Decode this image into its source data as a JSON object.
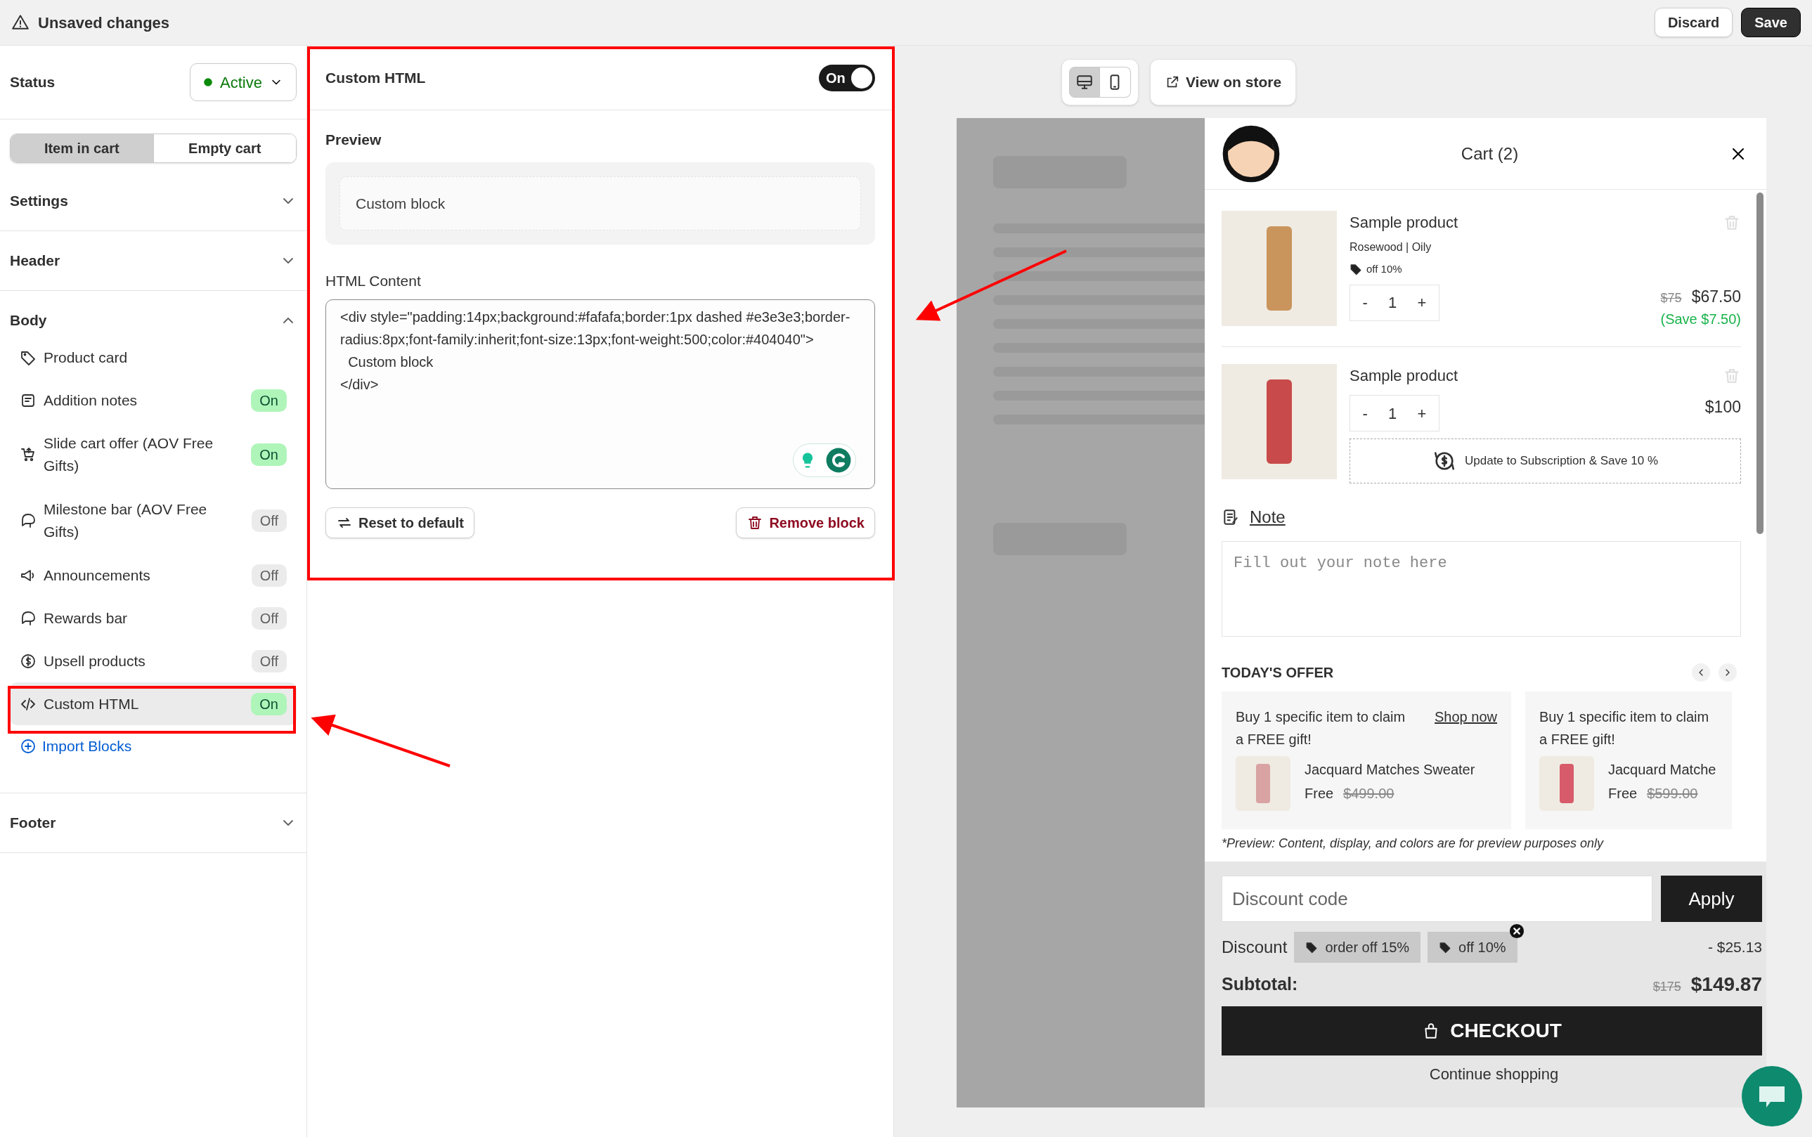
{
  "top_bar": {
    "title": "Unsaved changes",
    "buttons": [
      {
        "label": "Discard",
        "kind": "secondary"
      },
      {
        "label": "Save",
        "kind": "primary"
      }
    ]
  },
  "sidebar": {
    "status": {
      "label": "Status",
      "value": "Active"
    },
    "tabs": [
      {
        "label": "Item in cart",
        "selected": true
      },
      {
        "label": "Empty cart",
        "selected": false
      }
    ],
    "sections": [
      {
        "title": "Settings",
        "expanded": false
      },
      {
        "title": "Header",
        "expanded": false
      },
      {
        "title": "Body",
        "expanded": true,
        "items": [
          {
            "label": "Product card",
            "kind": "plain",
            "selected": false
          },
          {
            "label": "Addition notes",
            "kind": "toggle",
            "badge": "On",
            "on": true,
            "selected": false
          },
          {
            "label": "Slide cart offer (AOV Free Gifts)",
            "kind": "toggle",
            "badge": "On",
            "on": true,
            "selected": false
          },
          {
            "label": "Milestone bar (AOV Free Gifts)",
            "kind": "toggle",
            "badge": "Off",
            "on": false,
            "selected": false
          },
          {
            "label": "Announcements",
            "kind": "toggle",
            "badge": "Off",
            "on": false,
            "selected": false
          },
          {
            "label": "Rewards bar",
            "kind": "toggle",
            "badge": "Off",
            "on": false,
            "selected": false
          },
          {
            "label": "Upsell products",
            "kind": "toggle",
            "badge": "Off",
            "on": false,
            "selected": false
          },
          {
            "label": "Custom HTML",
            "kind": "toggle",
            "badge": "On",
            "on": true,
            "selected": true
          }
        ],
        "link": "Import Blocks"
      },
      {
        "title": "Footer",
        "expanded": false
      }
    ]
  },
  "editor": {
    "title": "Custom HTML",
    "toggle": {
      "label": "On",
      "on": true
    },
    "preview_label": "Preview",
    "preview_text": "Custom block",
    "content_label": "HTML Content",
    "content": "<div style=\"padding:14px;background:#fafafa;border:1px dashed #e3e3e3;border-radius:8px;font-family:inherit;font-size:13px;font-weight:500;color:#404040\">\n  Custom block\n</div>",
    "buttons": [
      {
        "label": "Reset to default",
        "kind": "neutral"
      },
      {
        "label": "Remove block",
        "kind": "danger"
      }
    ]
  },
  "preview_toolbar": {
    "view_modes": [
      {
        "kind": "desktop",
        "selected": true
      },
      {
        "kind": "mobile",
        "selected": false
      }
    ],
    "view_on_store": "View on store"
  },
  "cart": {
    "title": "Cart (2)",
    "stepper": {
      "decrease": "-",
      "increase": "+"
    },
    "items": [
      {
        "name": "Sample product",
        "variant": "Rosewood | Oily",
        "discount_tag": "off 10%",
        "quantity": "1",
        "original_price": "$75",
        "price": "$67.50",
        "savings": "(Save $7.50)"
      },
      {
        "name": "Sample product",
        "quantity": "1",
        "price": "$100",
        "subscription": "Update to Subscription & Save 10 %"
      }
    ],
    "note": {
      "label": "Note",
      "placeholder": "Fill out your note here"
    },
    "offers": {
      "title": "TODAY'S OFFER",
      "cards": [
        {
          "text": "Buy 1 specific item to claim a FREE gift!",
          "link": "Shop now",
          "product": "Jacquard Matches Sweater",
          "price": "Free",
          "original_price": "$499.00"
        },
        {
          "text": "Buy 1 specific item to claim a FREE gift!",
          "product": "Jacquard Matche",
          "price": "Free",
          "original_price": "$599.00"
        }
      ]
    },
    "disclaimer": "*Preview: Content, display, and colors are for preview purposes only",
    "discount_field": {
      "placeholder": "Discount code"
    },
    "apply": "Apply",
    "discount": {
      "label": "Discount",
      "tags": [
        "order off 15%",
        "off 10%"
      ],
      "amount": "- $25.13"
    },
    "subtotal": {
      "label": "Subtotal:",
      "original": "$175",
      "total": "$149.87"
    },
    "checkout": "CHECKOUT",
    "continue": "Continue shopping"
  }
}
